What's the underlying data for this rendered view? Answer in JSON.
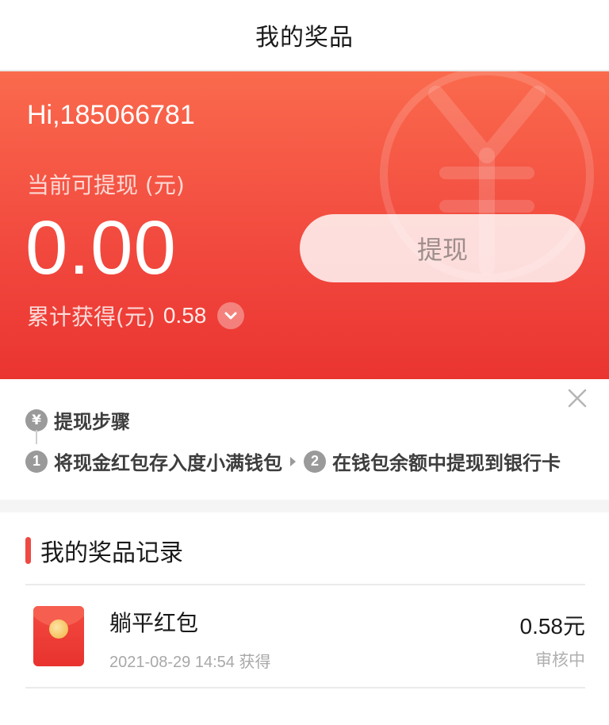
{
  "header": {
    "title": "我的奖品"
  },
  "hero": {
    "greeting": "Hi,185066781",
    "available_label": "当前可提现 (元)",
    "balance": "0.00",
    "withdraw_label": "提现",
    "total_label": "累计获得(元)",
    "total_value": "0.58",
    "watermark_icon": "yen-icon",
    "gradient_top": "#fa6a4d",
    "gradient_bottom": "#ea3430"
  },
  "steps": {
    "title": "提现步骤",
    "items": [
      {
        "num": "1",
        "text": "将现金红包存入度小满钱包"
      },
      {
        "num": "2",
        "text": "在钱包余额中提现到银行卡"
      }
    ],
    "badge_glyph": "¥",
    "close_icon": "close-icon"
  },
  "records": {
    "title": "我的奖品记录",
    "accent": "#ee4a42",
    "items": [
      {
        "name": "躺平红包",
        "time": "2021-08-29 14:54 获得",
        "amount": "0.58元",
        "status": "审核中",
        "icon": "red-envelope-icon"
      }
    ]
  }
}
